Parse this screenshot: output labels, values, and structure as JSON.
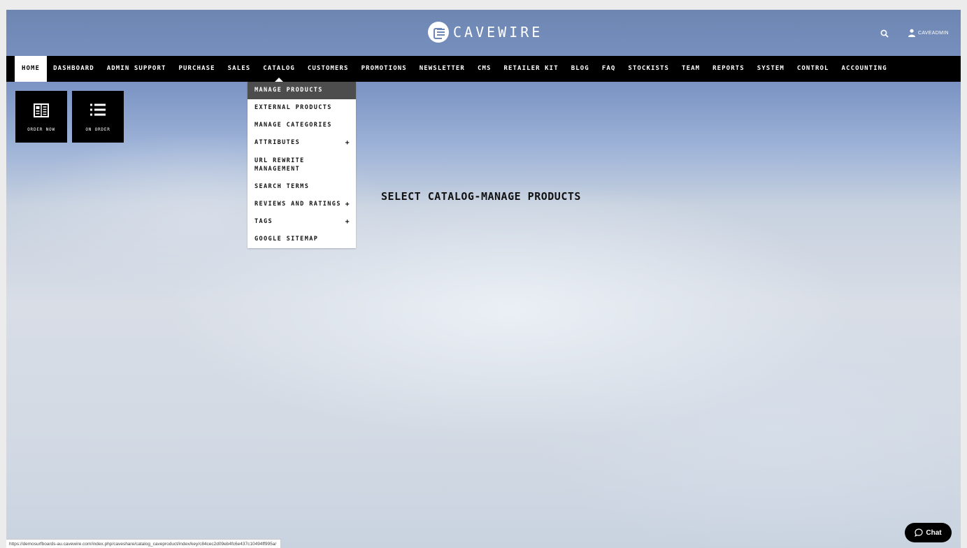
{
  "header": {
    "logo_text": "CAVEWIRE",
    "user_name": "CAVEADMIN"
  },
  "nav": {
    "items": [
      "HOME",
      "DASHBOARD",
      "ADMIN SUPPORT",
      "PURCHASE",
      "SALES",
      "CATALOG",
      "CUSTOMERS",
      "PROMOTIONS",
      "NEWSLETTER",
      "CMS",
      "RETAILER KIT",
      "BLOG",
      "FAQ",
      "STOCKISTS",
      "TEAM",
      "REPORTS",
      "SYSTEM",
      "CONTROL",
      "ACCOUNTING"
    ],
    "active": "HOME",
    "open_menu": "CATALOG"
  },
  "tiles": [
    {
      "label": "ORDER NOW",
      "icon": "book-icon"
    },
    {
      "label": "ON ORDER",
      "icon": "list-icon"
    }
  ],
  "catalog_menu": {
    "items": [
      {
        "label": "MANAGE PRODUCTS",
        "active": true,
        "has_submenu": false
      },
      {
        "label": "EXTERNAL PRODUCTS",
        "has_submenu": false
      },
      {
        "label": "MANAGE CATEGORIES",
        "has_submenu": false
      },
      {
        "label": "ATTRIBUTES",
        "has_submenu": true
      },
      {
        "label": "URL REWRITE MANAGEMENT",
        "has_submenu": false
      },
      {
        "label": "SEARCH TERMS",
        "has_submenu": false
      },
      {
        "label": "REVIEWS AND RATINGS",
        "has_submenu": true
      },
      {
        "label": "TAGS",
        "has_submenu": true
      },
      {
        "label": "GOOGLE SITEMAP",
        "has_submenu": false
      }
    ],
    "submenu_indicator": "+"
  },
  "main": {
    "instruction": "SELECT CATALOG-MANAGE PRODUCTS"
  },
  "status_bar": {
    "url": "https://demosurfboards-au.cavewire.com/index.php/caveshare/catalog_caveproduct/index/key/c84cec2d09eb4fc6e437c10494ff995a/"
  },
  "chat": {
    "label": "Chat"
  },
  "colors": {
    "navbar": "#000000",
    "menu_active": "#4d4d4d",
    "header_blue": "#6e86b2"
  }
}
